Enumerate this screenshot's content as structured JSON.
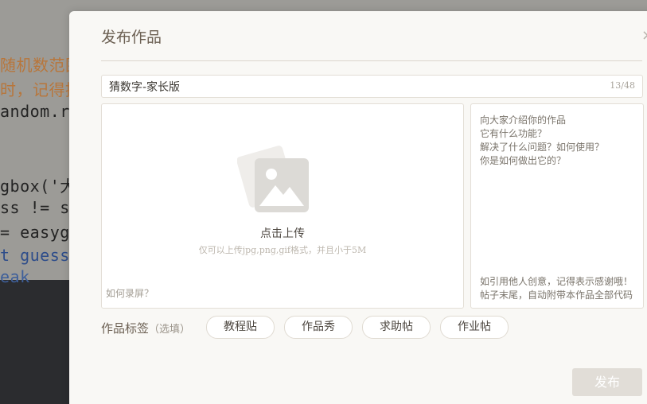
{
  "background_editor": {
    "lines": [
      {
        "text": "随机数范围",
        "kind": "comment"
      },
      {
        "text": "时，记得提",
        "kind": "comment"
      },
      {
        "text": "andom.ra",
        "kind": "code"
      },
      {
        "text": "gbox('大",
        "kind": "code"
      },
      {
        "text": "ss != se",
        "kind": "code"
      },
      {
        "text": "= easygu",
        "kind": "code"
      },
      {
        "text": "t guess)",
        "kind": "code"
      },
      {
        "text": "eak",
        "kind": "kw"
      }
    ]
  },
  "dialog": {
    "title": "发布作品",
    "close_icon": "close-icon",
    "title_input": {
      "value": "猜数字-家长版",
      "counter": "13/48"
    },
    "upload": {
      "icon": "image-placeholder-icon",
      "label": "点击上传",
      "hint": "仅可以上传jpg,png,gif格式，并且小于5M",
      "record_link": "如何录屏？"
    },
    "description": {
      "placeholder_lines": [
        "向大家介绍你的作品",
        "它有什么功能？",
        "解决了什么问题？如何使用？",
        "你是如何做出它的？"
      ],
      "footer_lines": [
        "如引用他人创意，记得表示感谢哦！",
        "帖子末尾，自动附带本作品全部代码"
      ]
    },
    "tags": {
      "label": "作品标签",
      "optional": "（选填）",
      "items": [
        "教程贴",
        "作品秀",
        "求助帖",
        "作业帖"
      ]
    },
    "publish_label": "发布"
  },
  "colors": {
    "dialog_bg": "#f9f8f5",
    "title_text": "#6b5f52",
    "publish_disabled": "#e1ddd7"
  }
}
